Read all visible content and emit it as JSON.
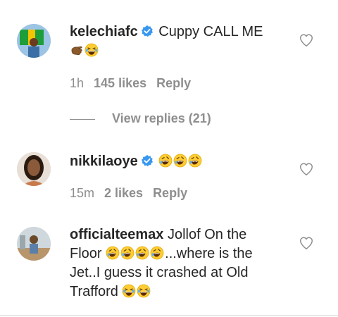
{
  "comments": [
    {
      "username": "kelechiafc",
      "verified": true,
      "text": "Cuppy CALL ME",
      "emojis": [
        "hand-icon",
        "laughing-icon"
      ],
      "time": "1h",
      "likes": "145 likes",
      "reply": "Reply",
      "view_replies": "View replies (21)"
    },
    {
      "username": "nikkilaoye",
      "verified": true,
      "text": "",
      "emojis": [
        "rofl-icon",
        "rofl-icon",
        "rofl-icon"
      ],
      "time": "15m",
      "likes": "2 likes",
      "reply": "Reply"
    },
    {
      "username": "officialteemax",
      "verified": false,
      "text_part1": "Jollof On the Floor",
      "text_part2": "...where is the Jet..I guess it crashed at Old Trafford",
      "emojis_mid": [
        "rofl-icon",
        "rofl-icon",
        "rofl-icon",
        "rofl-icon"
      ],
      "emojis_end": [
        "laughing-icon",
        "laughing-icon"
      ]
    }
  ],
  "colors": {
    "text": "#262626",
    "secondary": "#8e8e8e",
    "verified": "#3897f0"
  }
}
